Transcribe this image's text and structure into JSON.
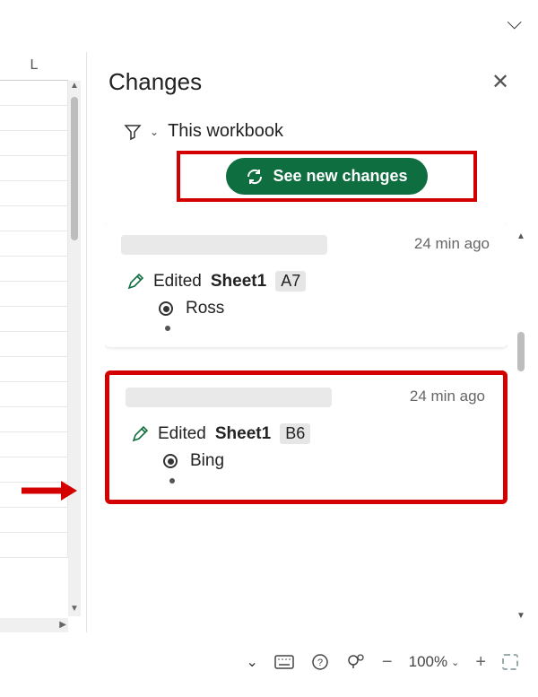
{
  "column_header": "L",
  "pane": {
    "title": "Changes",
    "filter_label": "This workbook",
    "see_new_label": "See new changes"
  },
  "changes": [
    {
      "time": "24 min ago",
      "action": "Edited",
      "sheet": "Sheet1",
      "cell": "A7",
      "value": "Ross",
      "highlight": false
    },
    {
      "time": "24 min ago",
      "action": "Edited",
      "sheet": "Sheet1",
      "cell": "B6",
      "value": "Bing",
      "highlight": true
    }
  ],
  "status": {
    "zoom": "100%"
  }
}
